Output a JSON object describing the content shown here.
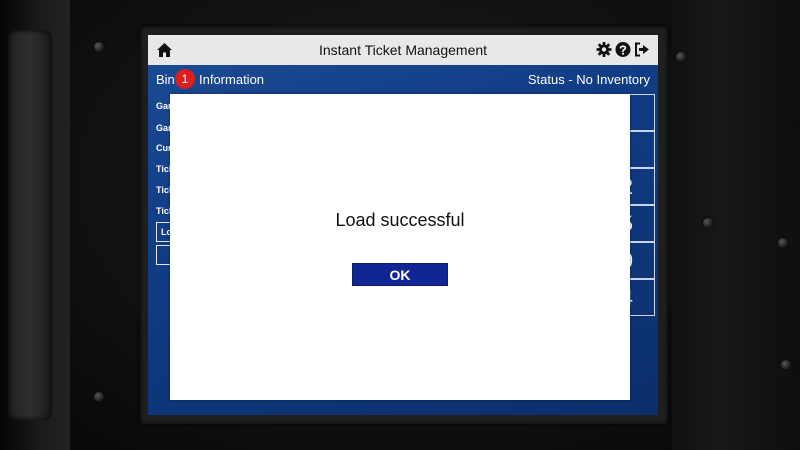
{
  "header": {
    "title": "Instant Ticket Management",
    "icons": [
      "home-icon",
      "gear-icon",
      "help-icon",
      "logout-icon"
    ]
  },
  "subheader": {
    "bin_label": "Bin",
    "bin_number": "1",
    "info_label": "Information",
    "status": "Status - No Inventory"
  },
  "background_form": {
    "row_labels": [
      "Gar",
      "Gar",
      "Cur",
      "Tick",
      "Tick",
      "Tick"
    ],
    "field_label": "Lo",
    "keypad_digits": [
      "2",
      "5",
      "0",
      "4"
    ]
  },
  "dialog": {
    "message": "Load successful",
    "ok_label": "OK"
  },
  "colors": {
    "screen_blue": "#103c84",
    "header_gray": "#e8e8e8",
    "badge_red": "#d8201e",
    "ok_button": "#0f2694"
  }
}
